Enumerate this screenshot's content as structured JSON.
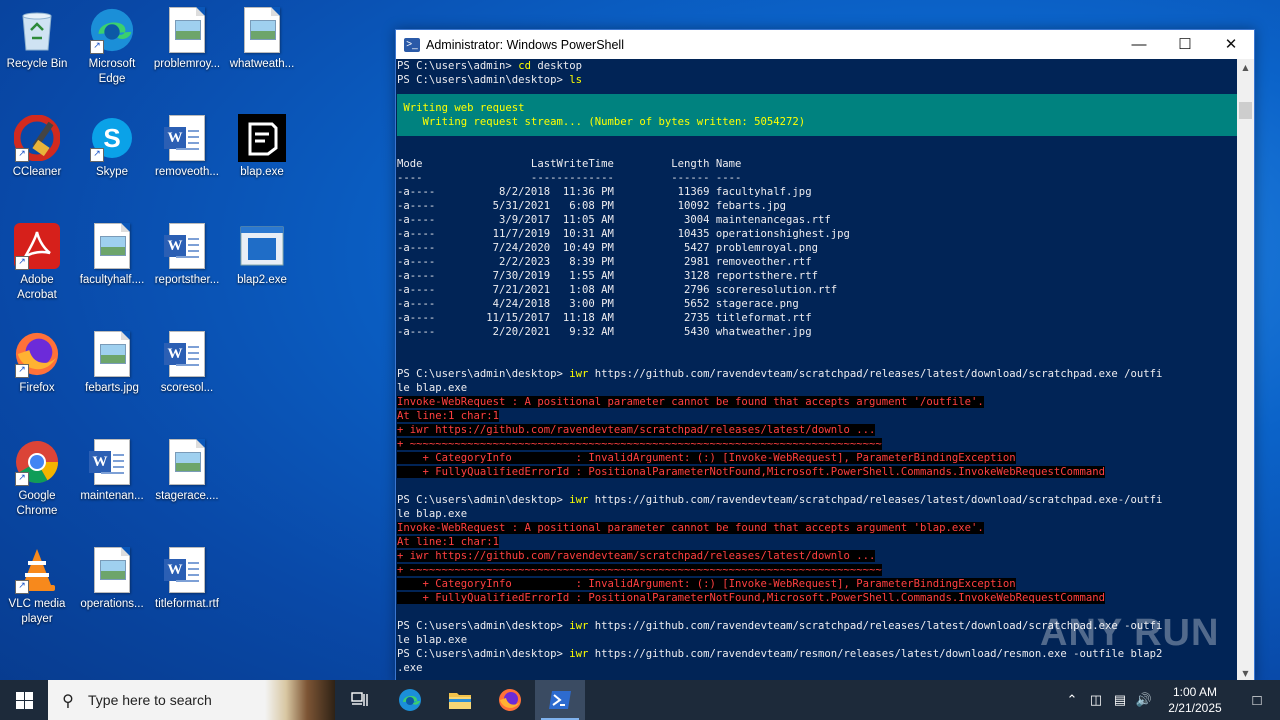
{
  "desktop": {
    "icons": [
      {
        "label": "Recycle Bin",
        "type": "recycle"
      },
      {
        "label": "Microsoft Edge",
        "type": "edge"
      },
      {
        "label": "problemroy...",
        "type": "image"
      },
      {
        "label": "whatweath...",
        "type": "image"
      },
      {
        "label": "CCleaner",
        "type": "ccleaner"
      },
      {
        "label": "Skype",
        "type": "skype"
      },
      {
        "label": "removeoth...",
        "type": "word"
      },
      {
        "label": "blap.exe",
        "type": "blap"
      },
      {
        "label": "Adobe Acrobat",
        "type": "acrobat"
      },
      {
        "label": "facultyhalf....",
        "type": "image"
      },
      {
        "label": "reportsther...",
        "type": "word"
      },
      {
        "label": "blap2.exe",
        "type": "exe"
      },
      {
        "label": "Firefox",
        "type": "firefox"
      },
      {
        "label": "febarts.jpg",
        "type": "image"
      },
      {
        "label": "scoresol...",
        "type": "word"
      },
      {
        "label": "Google Chrome",
        "type": "chrome"
      },
      {
        "label": "maintenan...",
        "type": "word"
      },
      {
        "label": "stagerace....",
        "type": "image"
      },
      {
        "label": "VLC media player",
        "type": "vlc"
      },
      {
        "label": "operations...",
        "type": "image"
      },
      {
        "label": "titleformat.rtf",
        "type": "word"
      }
    ]
  },
  "window": {
    "title": "Administrator: Windows PowerShell",
    "minimize": "—",
    "maximize": "☐",
    "close": "✕"
  },
  "terminal": {
    "pre": [
      "PS C:\\users\\admin> cd desktop",
      "PS C:\\users\\admin\\desktop> ls"
    ],
    "progress": [
      " Writing web request",
      "    Writing request stream... (Number of bytes written: 5054272)"
    ],
    "listing": [
      "Mode                 LastWriteTime         Length Name",
      "----                 -------------         ------ ----",
      "-a----          8/2/2018  11:36 PM          11369 facultyhalf.jpg",
      "-a----         5/31/2021   6:08 PM          10092 febarts.jpg",
      "-a----          3/9/2017  11:05 AM           3004 maintenancegas.rtf",
      "-a----         11/7/2019  10:31 AM          10435 operationshighest.jpg",
      "-a----         7/24/2020  10:49 PM           5427 problemroyal.png",
      "-a----          2/2/2023   8:39 PM           2981 removeother.rtf",
      "-a----         7/30/2019   1:55 AM           3128 reportsthere.rtf",
      "-a----         7/21/2021   1:08 AM           2796 scoreresolution.rtf",
      "-a----         4/24/2018   3:00 PM           5652 stagerace.png",
      "-a----        11/15/2017  11:18 AM           2735 titleformat.rtf",
      "-a----         2/20/2021   9:32 AM           5430 whatweather.jpg"
    ],
    "cmd1_prompt": "PS C:\\users\\admin\\desktop> ",
    "cmd1_word": "iwr",
    "cmd1_rest": " https://github.com/ravendevteam/scratchpad/releases/latest/download/scratchpad.exe /outfi",
    "cmd1_wrap": "le blap.exe",
    "err1": [
      "Invoke-WebRequest : A positional parameter cannot be found that accepts argument '/outfile'.",
      "At line:1 char:1",
      "+ iwr https://github.com/ravendevteam/scratchpad/releases/latest/downlo ...",
      "+ ~~~~~~~~~~~~~~~~~~~~~~~~~~~~~~~~~~~~~~~~~~~~~~~~~~~~~~~~~~~~~~~~~~~~~~~~~~",
      "    + CategoryInfo          : InvalidArgument: (:) [Invoke-WebRequest], ParameterBindingException",
      "    + FullyQualifiedErrorId : PositionalParameterNotFound,Microsoft.PowerShell.Commands.InvokeWebRequestCommand"
    ],
    "cmd2_prompt": "PS C:\\users\\admin\\desktop> ",
    "cmd2_word": "iwr",
    "cmd2_rest": " https://github.com/ravendevteam/scratchpad/releases/latest/download/scratchpad.exe-/outfi",
    "cmd2_wrap": "le blap.exe",
    "err2": [
      "Invoke-WebRequest : A positional parameter cannot be found that accepts argument 'blap.exe'.",
      "At line:1 char:1",
      "+ iwr https://github.com/ravendevteam/scratchpad/releases/latest/downlo ...",
      "+ ~~~~~~~~~~~~~~~~~~~~~~~~~~~~~~~~~~~~~~~~~~~~~~~~~~~~~~~~~~~~~~~~~~~~~~~~~~",
      "    + CategoryInfo          : InvalidArgument: (:) [Invoke-WebRequest], ParameterBindingException",
      "    + FullyQualifiedErrorId : PositionalParameterNotFound,Microsoft.PowerShell.Commands.InvokeWebRequestCommand"
    ],
    "cmd3_prompt": "PS C:\\users\\admin\\desktop> ",
    "cmd3_word": "iwr",
    "cmd3_rest": " https://github.com/ravendevteam/scratchpad/releases/latest/download/scratchpad.exe -outfi",
    "cmd3_wrap": "le blap.exe",
    "cmd4_prompt": "PS C:\\users\\admin\\desktop> ",
    "cmd4_word": "iwr",
    "cmd4_rest": " https://github.com/ravendevteam/resmon/releases/latest/download/resmon.exe -outfile blap2",
    "cmd4_wrap": ".exe"
  },
  "watermark": "ANY RUN",
  "taskbar": {
    "search_placeholder": "Type here to search",
    "time": "1:00 AM",
    "date": "2/21/2025"
  },
  "colors": {
    "terminal_bg": "#012456",
    "progress_bg": "#00827f",
    "error_red": "#ff4040",
    "command_yellow": "#ffff00"
  }
}
